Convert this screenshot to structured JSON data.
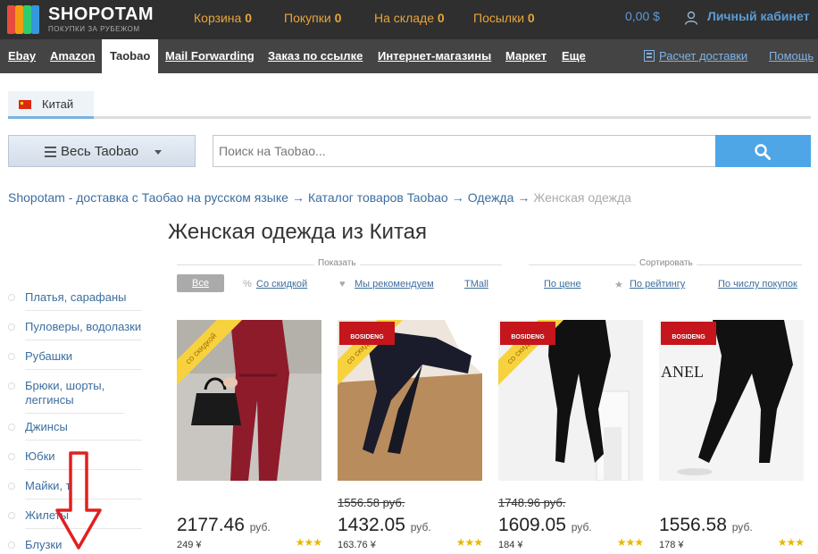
{
  "brand": {
    "name": "SHOPOTAM",
    "tagline": "ПОКУПКИ ЗА РУБЕЖОМ",
    "logo_colors": [
      "#e74c3c",
      "#f39c12",
      "#2ecc71",
      "#3498db"
    ]
  },
  "header": {
    "counters": [
      {
        "label": "Корзина",
        "count": "0"
      },
      {
        "label": "Покупки",
        "count": "0"
      },
      {
        "label": "На складе",
        "count": "0"
      },
      {
        "label": "Посылки",
        "count": "0"
      }
    ],
    "balance": "0,00 $",
    "cabinet": "Личный кабинет"
  },
  "nav": {
    "items": [
      "Ebay",
      "Amazon",
      "Taobao",
      "Mail Forwarding",
      "Заказ по ссылке",
      "Интернет-магазины",
      "Маркет",
      "Еще"
    ],
    "active": "Taobao",
    "delivery_calc": "Расчет доставки",
    "help": "Помощь"
  },
  "country_tab": "Китай",
  "search": {
    "category_button": "Весь Taobao",
    "placeholder": "Поиск на Taobao..."
  },
  "breadcrumb": {
    "items": [
      "Shopotam - доставка с Таобао на русском языке",
      "Каталог товаров Taobao",
      "Одежда"
    ],
    "current": "Женская одежда",
    "separator": "→"
  },
  "page_title": "Женская одежда из Китая",
  "filters": {
    "show_label": "Показать",
    "sort_label": "Сортировать",
    "show": [
      "Все",
      "Со скидкой",
      "Мы рекомендуем",
      "TMall"
    ],
    "sort": [
      "По цене",
      "По рейтингу",
      "По числу покупок"
    ]
  },
  "sidebar": {
    "categories": [
      "Платья, сарафаны",
      "Пуловеры, водолазки",
      "Рубашки",
      "Брюки, шорты, леггинсы",
      "Джинсы",
      "Юбки",
      "Майки, т",
      "Жилеты",
      "Блузки"
    ]
  },
  "products": [
    {
      "old_price": "",
      "price": "2177.46",
      "currency": "руб.",
      "yuan": "249 ¥",
      "stars": "★★★",
      "sale_badge": "со скидкой",
      "brand": ""
    },
    {
      "old_price": "1556.58 руб.",
      "price": "1432.05",
      "currency": "руб.",
      "yuan": "163.76 ¥",
      "stars": "★★★",
      "sale_badge": "со скидкой",
      "brand": "BOSIDENG"
    },
    {
      "old_price": "1748.96 руб.",
      "price": "1609.05",
      "currency": "руб.",
      "yuan": "184 ¥",
      "stars": "★★★",
      "sale_badge": "со скидкой",
      "brand": "BOSIDENG"
    },
    {
      "old_price": "",
      "price": "1556.58",
      "currency": "руб.",
      "yuan": "178 ¥",
      "stars": "★★★",
      "sale_badge": "",
      "brand": "BOSIDENG",
      "watermark": "ANEL"
    }
  ],
  "colors": {
    "topbar": "#2f2f2f",
    "navbar": "#444444",
    "accent_orange": "#e8a43a",
    "link_blue": "#3c6e9f",
    "search_button": "#4ea6e6",
    "annotation_arrow": "#e02020"
  }
}
